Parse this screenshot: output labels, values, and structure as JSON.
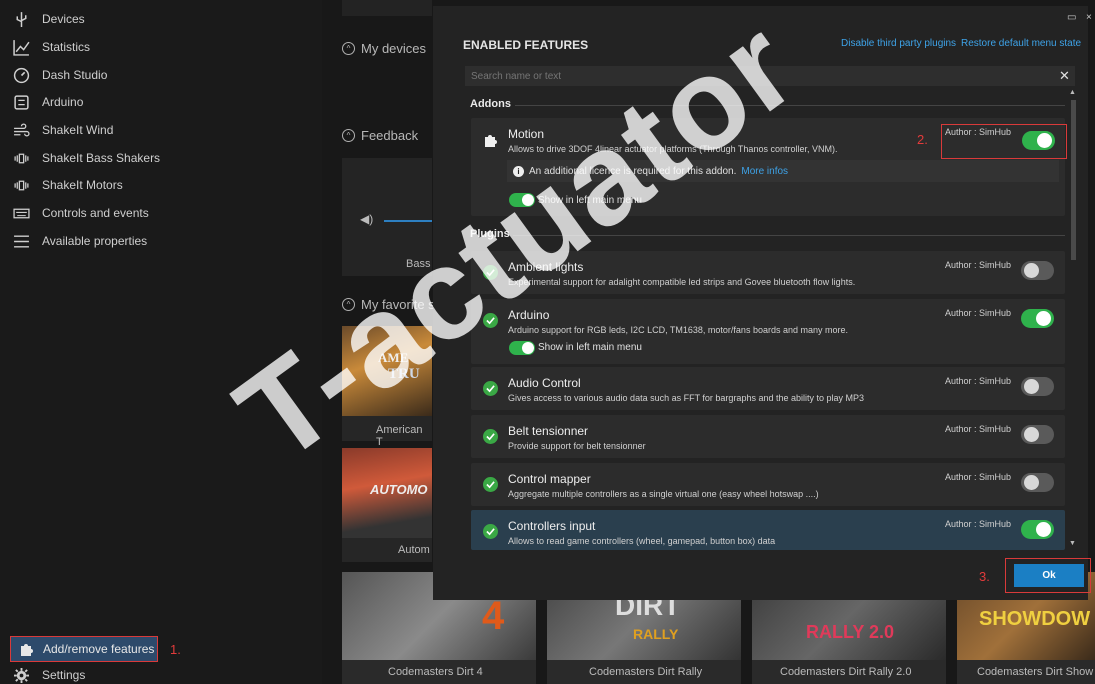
{
  "sidebar": {
    "items": [
      {
        "label": "Devices",
        "icon": "usb-icon"
      },
      {
        "label": "Statistics",
        "icon": "chart-icon"
      },
      {
        "label": "Dash Studio",
        "icon": "gauge-icon"
      },
      {
        "label": "Arduino",
        "icon": "board-icon"
      },
      {
        "label": "ShakeIt Wind",
        "icon": "wind-icon"
      },
      {
        "label": "ShakeIt Bass Shakers",
        "icon": "vibration-icon"
      },
      {
        "label": "ShakeIt Motors",
        "icon": "vibration-icon"
      },
      {
        "label": "Controls and events",
        "icon": "keyboard-icon"
      },
      {
        "label": "Available properties",
        "icon": "list-icon"
      }
    ],
    "features_label": "Add/remove features",
    "features_marker": "1.",
    "settings_label": "Settings"
  },
  "background": {
    "my_devices": "My devices",
    "feedback": "Feedback",
    "bass_label": "Bass",
    "favorites": "My favorite s",
    "game_american": "American T",
    "game_autom": "Autom",
    "bottom_games": [
      "Codemasters Dirt 4",
      "Codemasters Dirt Rally",
      "Codemasters Dirt Rally 2.0",
      "Codemasters Dirt Show"
    ],
    "tile_texts": {
      "ame": "AME",
      "tru": "TRU",
      "automo": "AUTOMO",
      "dirt4": "4",
      "dirt": "DIRT",
      "rally": "RALLY",
      "rally2": "RALLY 2.0",
      "showdown": "SHOWDOW"
    }
  },
  "dialog": {
    "title": "ENABLED FEATURES",
    "link_disable": "Disable third party plugins",
    "link_restore": "Restore default menu state",
    "search_placeholder": "Search name or text",
    "addons_header": "Addons",
    "plugins_header": "Plugins",
    "motion": {
      "name": "Motion",
      "desc": "Allows to drive 3DOF 4linear actuator platforms (Through Thanos controller, VNM).",
      "author": "Author : SimHub",
      "enabled": true,
      "notice": "An additional licence is required for this addon.",
      "notice_link": "More infos",
      "show_menu": "Show in left main menu",
      "marker": "2."
    },
    "plugins": [
      {
        "name": "Ambient lights",
        "desc": "Experimental support for adalight compatible led strips and Govee bluetooth flow lights.",
        "author": "Author : SimHub",
        "enabled": false
      },
      {
        "name": "Arduino",
        "desc": "Arduino support for RGB leds, I2C LCD, TM1638, motor/fans boards and many more.",
        "author": "Author : SimHub",
        "enabled": true,
        "show_menu": "Show in left main menu"
      },
      {
        "name": "Audio Control",
        "desc": "Gives access to various audio data such as FFT for bargraphs and the ability to play MP3",
        "author": "Author : SimHub",
        "enabled": false
      },
      {
        "name": "Belt tensionner",
        "desc": "Provide support for belt tensionner",
        "author": "Author : SimHub",
        "enabled": false
      },
      {
        "name": "Control mapper",
        "desc": "Aggregate multiple controllers as a single virtual one (easy wheel hotswap ....)",
        "author": "Author : SimHub",
        "enabled": false
      },
      {
        "name": "Controllers input",
        "desc": "Allows to read game controllers (wheel, gamepad, button box) data",
        "author": "Author : SimHub",
        "enabled": true
      }
    ],
    "ok_label": "Ok",
    "ok_marker": "3."
  },
  "watermark": "T-actuator",
  "colors": {
    "accent": "#1b7fc4",
    "toggle_on": "#2fb24c",
    "marker_red": "#e23b3b",
    "link": "#3ea3e8"
  }
}
